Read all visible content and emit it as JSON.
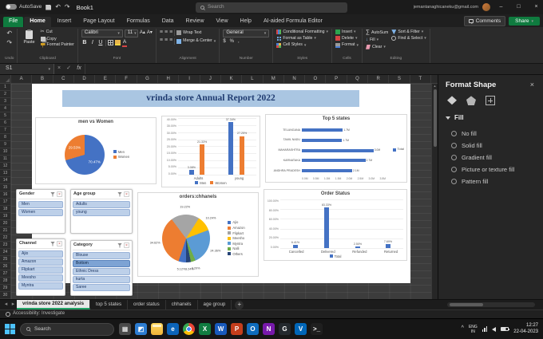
{
  "window": {
    "titlebar": {
      "autosave_label": "AutoSave",
      "workbook_name": "Book1",
      "search_placeholder": "Search",
      "user_email": "jemantanaghicaneku@gmail.com",
      "minimize_icon": "–",
      "maximize_icon": "□",
      "close_icon": "×"
    }
  },
  "menu": {
    "tabs": [
      "File",
      "Home",
      "Insert",
      "Page Layout",
      "Formulas",
      "Data",
      "Review",
      "View",
      "Help",
      "AI-aided Formula Editor"
    ],
    "active_tab": "Home",
    "comments_label": "Comments",
    "share_label": "Share"
  },
  "ribbon": {
    "undo_label": "Undo",
    "clipboard": {
      "label": "Clipboard",
      "paste": "Paste",
      "cut": "Cut",
      "copy": "Copy",
      "format_painter": "Format Painter"
    },
    "font": {
      "label": "Font",
      "font_name": "Calibri",
      "font_size": "11",
      "bold": "B",
      "italic": "I",
      "underline": "U"
    },
    "alignment": {
      "label": "Alignment",
      "wrap_text": "Wrap Text",
      "merge_center": "Merge & Center"
    },
    "number": {
      "label": "Number",
      "format": "General",
      "currency": "$",
      "percent": "%",
      "comma": ","
    },
    "styles": {
      "label": "Styles",
      "conditional": "Conditional Formatting",
      "format_table": "Format as Table",
      "cell_styles": "Cell Styles"
    },
    "cells": {
      "label": "Cells",
      "insert": "Insert",
      "delete": "Delete",
      "format": "Format"
    },
    "editing": {
      "label": "Editing",
      "autosum": "AutoSum",
      "fill": "Fill",
      "clear": "Clear",
      "sort_filter": "Sort & Filter",
      "find_select": "Find & Select"
    }
  },
  "formula_bar": {
    "name_box": "S1",
    "fx": "fx"
  },
  "grid": {
    "columns": [
      "A",
      "B",
      "C",
      "D",
      "E",
      "F",
      "G",
      "H",
      "I",
      "J",
      "K",
      "L",
      "M",
      "N",
      "O",
      "P",
      "Q",
      "R",
      "S",
      "T"
    ],
    "row_count": 30
  },
  "dashboard": {
    "title": "vrinda store Annual Report 2022"
  },
  "slicers": [
    {
      "title": "Gender",
      "items": [
        "Men",
        "Women"
      ],
      "highlight": -1
    },
    {
      "title": "Age group",
      "items": [
        "Adults",
        "young"
      ],
      "highlight": -1
    },
    {
      "title": "Channel",
      "items": [
        "Ajio",
        "Amazon",
        "Flipkart",
        "Meesho",
        "Myntra"
      ],
      "highlight": -1
    },
    {
      "title": "Category",
      "items": [
        "Blouse",
        "Bottom",
        "Ethnic Dress",
        "kurta",
        "Saree"
      ],
      "highlight": 1
    }
  ],
  "chart_data": [
    {
      "id": "men-vs-women",
      "type": "pie",
      "title": "men vs Women",
      "labels": [
        "Men",
        "Women"
      ],
      "values": [
        70.47,
        29.53
      ],
      "colors": [
        "#4472c4",
        "#ed7d31"
      ],
      "data_labels": [
        "70.47%",
        "29.53%"
      ],
      "label_style": "inside",
      "start_angle": 0,
      "legend_position": "right"
    },
    {
      "id": "age-vs-gender",
      "type": "bar",
      "title": "",
      "categories": [
        "Adults",
        "young"
      ],
      "series": [
        {
          "name": "Men",
          "color": "#4472c4",
          "values": [
            3.08,
            37.34
          ]
        },
        {
          "name": "Women",
          "color": "#ed7d31",
          "values": [
            21.33,
            27.25
          ]
        }
      ],
      "data_labels": [
        [
          "3.08%",
          "37.34%"
        ],
        [
          "21.33%",
          "27.25%"
        ]
      ],
      "ylim": [
        0,
        40
      ],
      "yticks": [
        "40.00%",
        "35.00%",
        "30.00%",
        "25.00%",
        "20.00%",
        "15.00%",
        "10.00%",
        "5.00%",
        "0.00%"
      ],
      "legend_position": "bottom"
    },
    {
      "id": "top-5-states",
      "type": "hbar",
      "title": "Top 5 states",
      "categories": [
        "TELANGANA",
        "TAMIL NADU",
        "MAHARASHTRA",
        "KARNATAKA",
        "ANDHRA PRADESH"
      ],
      "values": [
        1.71,
        1.68,
        2.99,
        2.65,
        2.1
      ],
      "value_labels": [
        "1.7M",
        "1.7M",
        "3.0M",
        "2.7M",
        "2.1M"
      ],
      "color": "#4472c4",
      "legend": "Total",
      "xlim": [
        0,
        3.5
      ],
      "xticks": [
        "0.0M",
        "0.5M",
        "1.0M",
        "1.5M",
        "2.0M",
        "2.5M",
        "3.0M",
        "3.5M"
      ]
    },
    {
      "id": "orders-channels",
      "type": "pie",
      "title": "orders:chhanels",
      "labels": [
        "Ajio",
        "Amazon",
        "Flipkart",
        "Meesho",
        "Myntra",
        "Nalli",
        "Others"
      ],
      "values": [
        5.12,
        34.62,
        19.22,
        10.24,
        24.36,
        3.2,
        3.24
      ],
      "colors": [
        "#4472c4",
        "#ed7d31",
        "#a5a5a5",
        "#ffc000",
        "#5b9bd5",
        "#70ad47",
        "#264478"
      ],
      "data_labels": [
        "5.12%",
        "34.62%",
        "19.22%",
        "10.24%",
        "24.36%",
        "3.20%",
        "3.24%"
      ],
      "label_style": "outside",
      "start_angle": 180,
      "legend_position": "right"
    },
    {
      "id": "order-status",
      "type": "bar",
      "title": "Order Status",
      "categories": [
        "Cancelled",
        "Delivered",
        "Refunded",
        "Returned"
      ],
      "series": [
        {
          "name": "Total",
          "color": "#4472c4",
          "values": [
            6.41,
            83.33,
            2.5,
            7.69
          ]
        }
      ],
      "data_labels": [
        "6.41%",
        "83.33%",
        "2.50%",
        "7.69%"
      ],
      "ylim": [
        0,
        100
      ],
      "yticks": [
        "100.00%",
        "80.00%",
        "60.00%",
        "40.00%",
        "20.00%",
        "0.00%"
      ],
      "legend_position": "bottom"
    }
  ],
  "format_shape": {
    "title": "Format Shape",
    "fill_section_label": "Fill",
    "options": [
      "No fill",
      "Solid fill",
      "Gradient fill",
      "Picture or texture fill",
      "Pattern fill"
    ]
  },
  "sheet_tabs": {
    "tabs": [
      "vrinda store 2022 analysis",
      "top 5 states",
      "order status",
      "chhanels",
      "age group"
    ],
    "active": "vrinda store 2022 analysis",
    "add_label": "+"
  },
  "status_bar": {
    "accessibility": "Accessibility: Investigate"
  },
  "taskbar": {
    "search_label": "Search",
    "apps": [
      {
        "name": "task-view",
        "label": "▦",
        "bg": "#4a4a4a"
      },
      {
        "name": "widgets",
        "label": "◩",
        "bg": "#2d7dd2"
      },
      {
        "name": "file-explorer",
        "label": "",
        "bg": ""
      },
      {
        "name": "edge",
        "label": "e",
        "bg": "#0b63b8"
      },
      {
        "name": "chrome",
        "label": "",
        "bg": ""
      },
      {
        "name": "excel",
        "label": "X",
        "bg": "#107c41"
      },
      {
        "name": "word",
        "label": "W",
        "bg": "#185abd"
      },
      {
        "name": "powerpoint",
        "label": "P",
        "bg": "#c43e1c"
      },
      {
        "name": "outlook",
        "label": "O",
        "bg": "#0f6cbd"
      },
      {
        "name": "onenote",
        "label": "N",
        "bg": "#7719aa"
      },
      {
        "name": "github",
        "label": "G",
        "bg": "#24292e"
      },
      {
        "name": "vscode",
        "label": "V",
        "bg": "#0066b8"
      },
      {
        "name": "terminal",
        "label": "&gt;_",
        "bg": "#1f1f1f"
      }
    ],
    "language": "ENG",
    "region": "IN",
    "time": "12:27",
    "date": "22-04-2023"
  }
}
